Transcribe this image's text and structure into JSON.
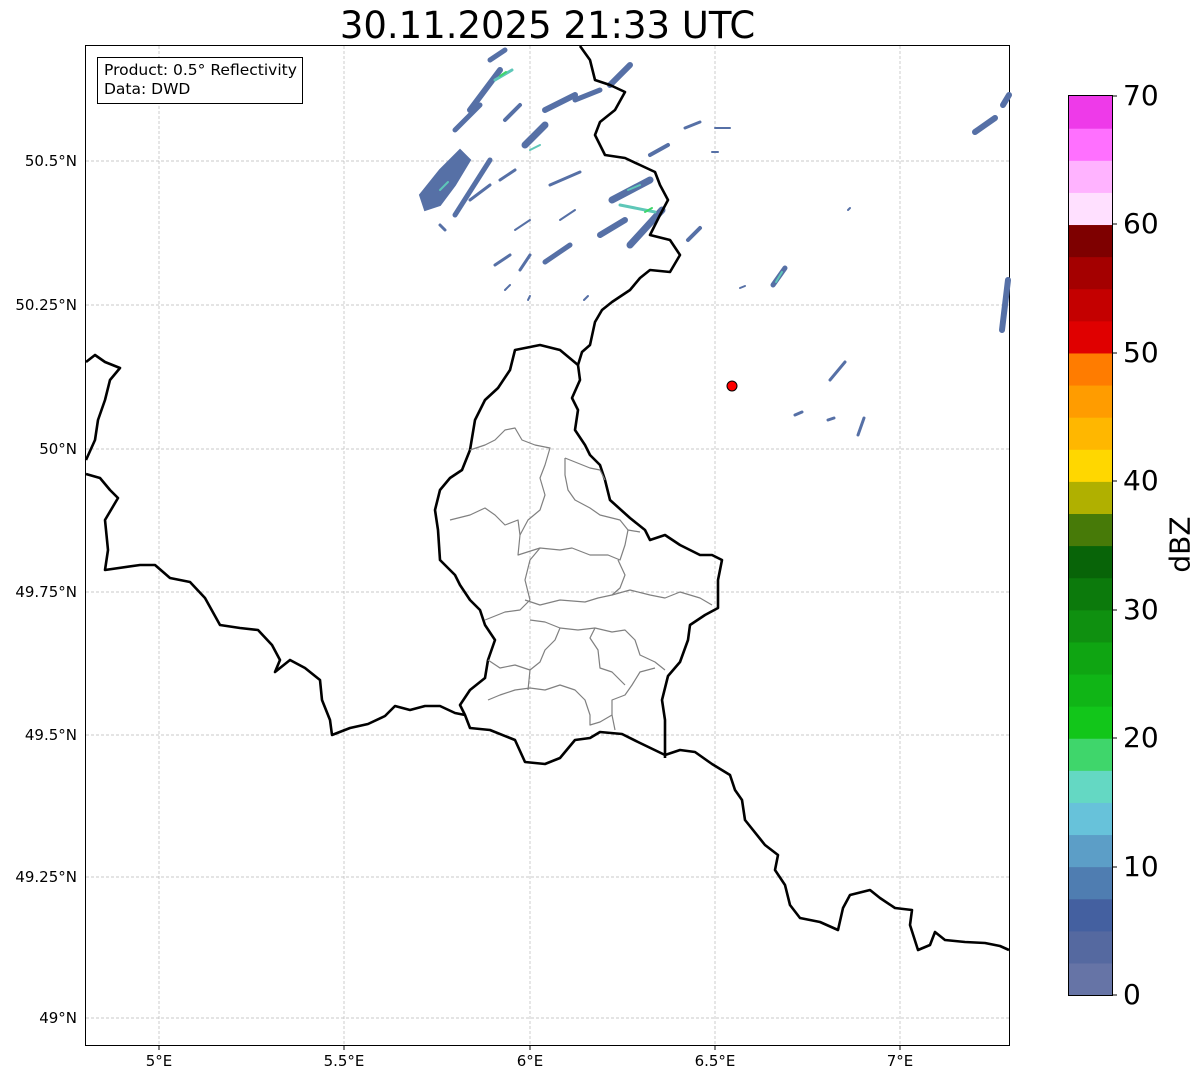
{
  "map": {
    "title": "30.11.2025 21:33 UTC",
    "info_lines": [
      "Product: 0.5° Reflectivity",
      "Data: DWD"
    ],
    "lon_ticks": [
      "5°E",
      "5.5°E",
      "6°E",
      "6.5°E",
      "7°E"
    ],
    "lat_ticks": [
      "50.5°N",
      "50.25°N",
      "50°N",
      "49.75°N",
      "49.5°N",
      "49.25°N",
      "49°N"
    ],
    "colorbar": {
      "unit": "dBZ",
      "tick_labels": [
        "70",
        "60",
        "50",
        "40",
        "30",
        "20",
        "10",
        "0"
      ],
      "colors": [
        "#6674a6",
        "#5569a0",
        "#4460a0",
        "#4f7db1",
        "#5c9ec7",
        "#67c2da",
        "#64d8c3",
        "#3fd66b",
        "#12c61a",
        "#10b516",
        "#0fa512",
        "#0f9010",
        "#0c7a0c",
        "#086408",
        "#477a08",
        "#b0b000",
        "#ffd700",
        "#ffb700",
        "#ff9c00",
        "#ff7c00",
        "#e00000",
        "#c40000",
        "#a40000",
        "#7e0000",
        "#ffe0ff",
        "#ffb3ff",
        "#ff70ff",
        "#ee3ae9"
      ]
    },
    "marker_color": "#ff0000",
    "border_color": "#000000",
    "canton_color": "#808080"
  }
}
